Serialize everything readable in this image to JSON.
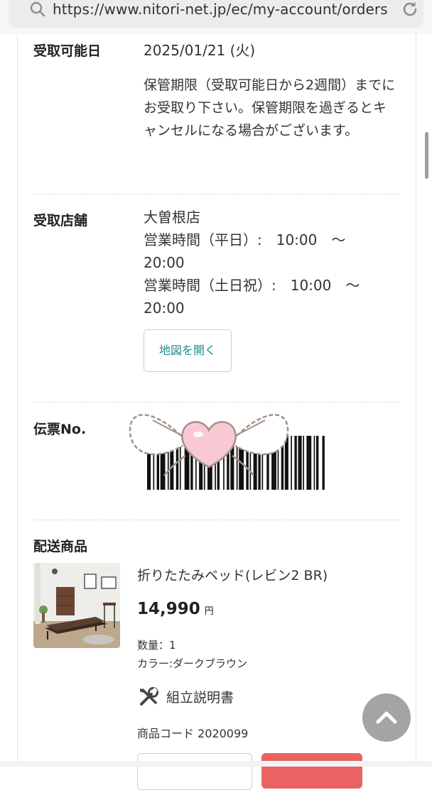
{
  "browser": {
    "url": "https://www.nitori-net.jp/ec/my-account/orders"
  },
  "pickup": {
    "date_label": "受取可能日",
    "date_value": "2025/01/21 (火)",
    "date_note": "保管期限（受取可能日から2週間）までにお受取り下さい。保管期限を過ぎるとキャンセルになる場合がございます。",
    "store_label": "受取店舗",
    "store_name": "大曽根店",
    "hours_weekday_1": "営業時間（平日）:　10:00　〜",
    "hours_weekday_2": "20:00",
    "hours_weekend_1": "営業時間（土日祝）:　10:00　〜",
    "hours_weekend_2": "20:00",
    "map_button": "地図を開く"
  },
  "slip": {
    "label": "伝票No."
  },
  "delivery": {
    "label": "配送商品",
    "product_name": "折りたたみベッド(レビン2 BR)",
    "price": "14,990",
    "price_unit": "円",
    "quantity": "数量：1",
    "color": "カラー:ダークブラウン",
    "manual_link": "組立説明書",
    "product_code": "商品コード 2020099"
  },
  "colors": {
    "accent_teal": "#1a8c8c",
    "button_red": "#e96363",
    "to_top_gray": "#a4a4a4"
  },
  "icons": [
    "search-icon",
    "reload-icon",
    "tools-icon",
    "chevron-up-icon"
  ]
}
